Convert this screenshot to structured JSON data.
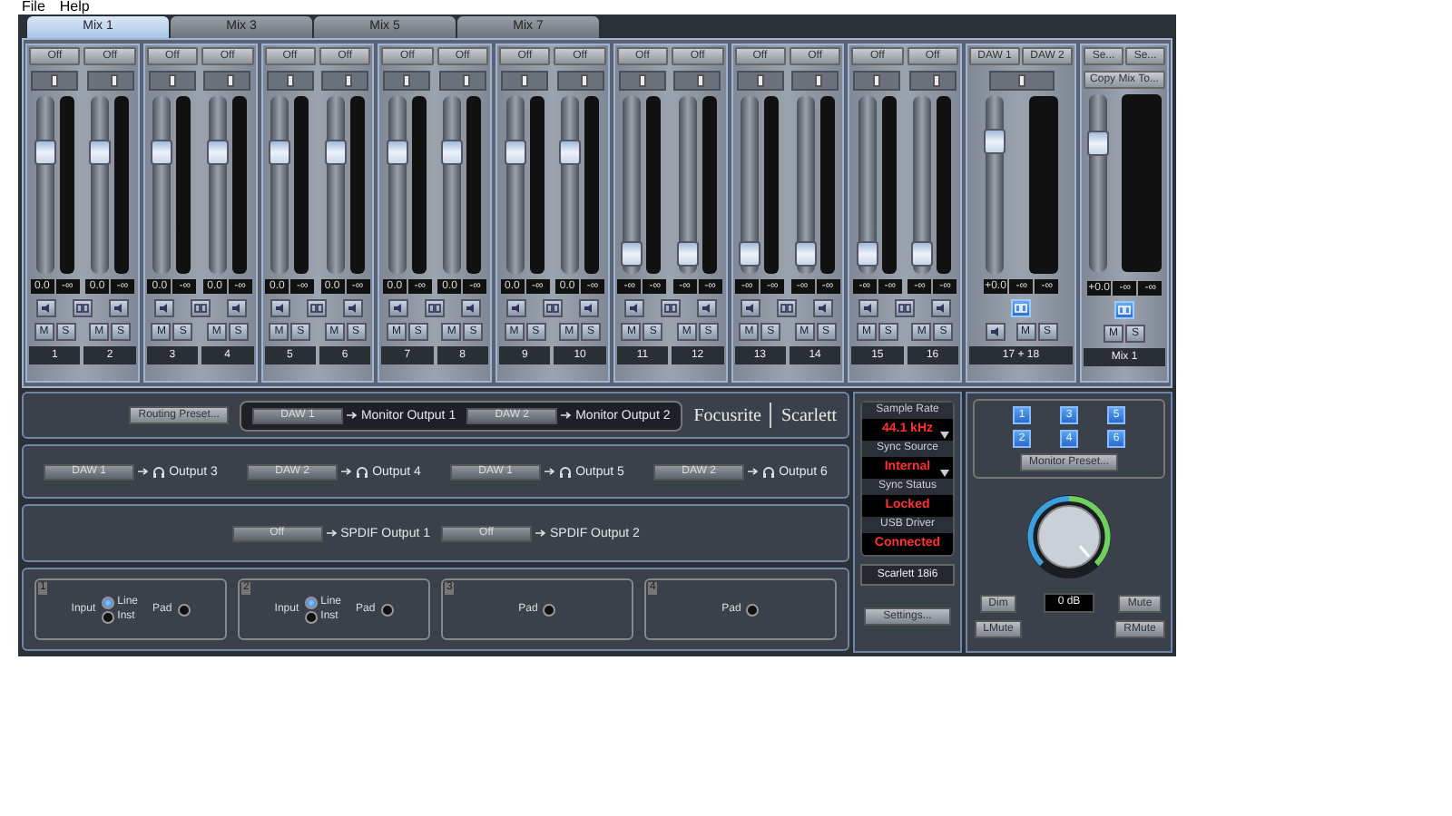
{
  "menu": [
    "File",
    "Help"
  ],
  "tabs": [
    {
      "label": "Mix 1",
      "selected": true
    },
    {
      "label": "Mix 3",
      "selected": false
    },
    {
      "label": "Mix 5",
      "selected": false
    },
    {
      "label": "Mix 7",
      "selected": false
    }
  ],
  "channel_pairs": [
    {
      "linked": false,
      "channels": [
        {
          "source": "Off",
          "pan": {
            "level": 0.5
          },
          "fader": {
            "level": 0.72
          },
          "readings": [
            "0.0",
            "-∞"
          ],
          "mute": {
            "label": "M",
            "on": false
          },
          "solo": {
            "label": "S",
            "on": false
          },
          "label": "1"
        },
        {
          "source": "Off",
          "pan": {
            "level": 0.6
          },
          "fader": {
            "level": 0.72
          },
          "readings": [
            "0.0",
            "-∞"
          ],
          "mute": {
            "label": "M",
            "on": false
          },
          "solo": {
            "label": "S",
            "on": false
          },
          "label": "2"
        }
      ]
    },
    {
      "linked": false,
      "channels": [
        {
          "source": "Off",
          "pan": {
            "level": 0.5
          },
          "fader": {
            "level": 0.72
          },
          "readings": [
            "0.0",
            "-∞"
          ],
          "mute": {
            "label": "M",
            "on": false
          },
          "solo": {
            "label": "S",
            "on": false
          },
          "label": "3"
        },
        {
          "source": "Off",
          "pan": {
            "level": 0.6
          },
          "fader": {
            "level": 0.72
          },
          "readings": [
            "0.0",
            "-∞"
          ],
          "mute": {
            "label": "M",
            "on": false
          },
          "solo": {
            "label": "S",
            "on": false
          },
          "label": "4"
        }
      ]
    },
    {
      "linked": false,
      "channels": [
        {
          "source": "Off",
          "pan": {
            "level": 0.5
          },
          "fader": {
            "level": 0.72
          },
          "readings": [
            "0.0",
            "-∞"
          ],
          "mute": {
            "label": "M",
            "on": false
          },
          "solo": {
            "label": "S",
            "on": false
          },
          "label": "5"
        },
        {
          "source": "Off",
          "pan": {
            "level": 0.6
          },
          "fader": {
            "level": 0.72
          },
          "readings": [
            "0.0",
            "-∞"
          ],
          "mute": {
            "label": "M",
            "on": false
          },
          "solo": {
            "label": "S",
            "on": false
          },
          "label": "6"
        }
      ]
    },
    {
      "linked": false,
      "channels": [
        {
          "source": "Off",
          "pan": {
            "level": 0.5
          },
          "fader": {
            "level": 0.72
          },
          "readings": [
            "0.0",
            "-∞"
          ],
          "mute": {
            "label": "M",
            "on": false
          },
          "solo": {
            "label": "S",
            "on": false
          },
          "label": "7"
        },
        {
          "source": "Off",
          "pan": {
            "level": 0.6
          },
          "fader": {
            "level": 0.72
          },
          "readings": [
            "0.0",
            "-∞"
          ],
          "mute": {
            "label": "M",
            "on": false
          },
          "solo": {
            "label": "S",
            "on": false
          },
          "label": "8"
        }
      ]
    },
    {
      "linked": false,
      "channels": [
        {
          "source": "Off",
          "pan": {
            "level": 0.5
          },
          "fader": {
            "level": 0.72
          },
          "readings": [
            "0.0",
            "-∞"
          ],
          "mute": {
            "label": "M",
            "on": false
          },
          "solo": {
            "label": "S",
            "on": false
          },
          "label": "9"
        },
        {
          "source": "Off",
          "pan": {
            "level": 0.6
          },
          "fader": {
            "level": 0.72
          },
          "readings": [
            "0.0",
            "-∞"
          ],
          "mute": {
            "label": "M",
            "on": false
          },
          "solo": {
            "label": "S",
            "on": false
          },
          "label": "10"
        }
      ]
    },
    {
      "linked": false,
      "channels": [
        {
          "source": "Off",
          "pan": {
            "level": 0.5
          },
          "fader": {
            "level": 0.05
          },
          "readings": [
            "-∞",
            "-∞"
          ],
          "mute": {
            "label": "M",
            "on": false
          },
          "solo": {
            "label": "S",
            "on": false
          },
          "label": "11"
        },
        {
          "source": "Off",
          "pan": {
            "level": 0.6
          },
          "fader": {
            "level": 0.05
          },
          "readings": [
            "-∞",
            "-∞"
          ],
          "mute": {
            "label": "M",
            "on": false
          },
          "solo": {
            "label": "S",
            "on": false
          },
          "label": "12"
        }
      ]
    },
    {
      "linked": false,
      "channels": [
        {
          "source": "Off",
          "pan": {
            "level": 0.5
          },
          "fader": {
            "level": 0.05
          },
          "readings": [
            "-∞",
            "-∞"
          ],
          "mute": {
            "label": "M",
            "on": false
          },
          "solo": {
            "label": "S",
            "on": false
          },
          "label": "13"
        },
        {
          "source": "Off",
          "pan": {
            "level": 0.6
          },
          "fader": {
            "level": 0.05
          },
          "readings": [
            "-∞",
            "-∞"
          ],
          "mute": {
            "label": "M",
            "on": false
          },
          "solo": {
            "label": "S",
            "on": false
          },
          "label": "14"
        }
      ]
    },
    {
      "linked": false,
      "channels": [
        {
          "source": "Off",
          "pan": {
            "level": 0.5
          },
          "fader": {
            "level": 0.05
          },
          "readings": [
            "-∞",
            "-∞"
          ],
          "mute": {
            "label": "M",
            "on": false
          },
          "solo": {
            "label": "S",
            "on": false
          },
          "label": "15"
        },
        {
          "source": "Off",
          "pan": {
            "level": 0.6
          },
          "fader": {
            "level": 0.05
          },
          "readings": [
            "-∞",
            "-∞"
          ],
          "mute": {
            "label": "M",
            "on": false
          },
          "solo": {
            "label": "S",
            "on": false
          },
          "label": "16"
        }
      ]
    }
  ],
  "stereo_return": {
    "sources": [
      "DAW 1",
      "DAW 2"
    ],
    "pan": {
      "level": 0.5
    },
    "fader": {
      "level": 0.78
    },
    "readings": [
      "+0.0",
      "-∞",
      "-∞"
    ],
    "linked": true,
    "mute": {
      "label": "M",
      "on": false
    },
    "solo": {
      "label": "S",
      "on": false
    },
    "label": "17 + 18"
  },
  "mix_bus": {
    "selectors": [
      "Se...",
      "Se..."
    ],
    "copy_button": "Copy Mix To...",
    "fader": {
      "level": 0.76
    },
    "readings": [
      "+0.0",
      "-∞",
      "-∞"
    ],
    "linked": true,
    "mute": {
      "label": "M",
      "on": false
    },
    "solo": {
      "label": "S",
      "on": false
    },
    "label": "Mix 1"
  },
  "routing": {
    "preset_button": "Routing Preset...",
    "monitor_outputs": [
      {
        "source": "DAW 1",
        "label": "Monitor Output 1"
      },
      {
        "source": "DAW 2",
        "label": "Monitor Output 2"
      }
    ],
    "headphone_outputs": [
      {
        "source": "DAW 1",
        "label": "Output 3"
      },
      {
        "source": "DAW 2",
        "label": "Output 4"
      },
      {
        "source": "DAW 1",
        "label": "Output 5"
      },
      {
        "source": "DAW 2",
        "label": "Output 6"
      }
    ],
    "spdif_outputs": [
      {
        "source": "Off",
        "label": "SPDIF Output 1"
      },
      {
        "source": "Off",
        "label": "SPDIF Output 2"
      }
    ]
  },
  "logo": {
    "brand": "Focusrite",
    "product": "Scarlett"
  },
  "inputs": [
    {
      "number": "1",
      "kind": "switchable",
      "input_label": "Input",
      "options": [
        {
          "label": "Line",
          "selected": true
        },
        {
          "label": "Inst",
          "selected": false
        }
      ],
      "pad_label": "Pad",
      "pad_on": false
    },
    {
      "number": "2",
      "kind": "switchable",
      "input_label": "Input",
      "options": [
        {
          "label": "Line",
          "selected": true
        },
        {
          "label": "Inst",
          "selected": false
        }
      ],
      "pad_label": "Pad",
      "pad_on": false
    },
    {
      "number": "3",
      "kind": "pad_only",
      "pad_label": "Pad",
      "pad_on": false
    },
    {
      "number": "4",
      "kind": "pad_only",
      "pad_label": "Pad",
      "pad_on": false
    }
  ],
  "status": [
    {
      "label": "Sample Rate",
      "value": "44.1 kHz",
      "dropdown": true
    },
    {
      "label": "Sync Source",
      "value": "Internal",
      "dropdown": true
    },
    {
      "label": "Sync Status",
      "value": "Locked",
      "dropdown": false
    },
    {
      "label": "USB Driver",
      "value": "Connected",
      "dropdown": false
    }
  ],
  "device": "Scarlett 18i6",
  "settings_button": "Settings...",
  "monitor": {
    "presets": [
      {
        "label": "1"
      },
      {
        "label": "3"
      },
      {
        "label": "5"
      },
      {
        "label": "2"
      },
      {
        "label": "4"
      },
      {
        "label": "6"
      }
    ],
    "preset_button": "Monitor Preset...",
    "volume": "0 dB",
    "buttons": [
      "Dim",
      "Mute",
      "LMute",
      "RMute"
    ]
  }
}
